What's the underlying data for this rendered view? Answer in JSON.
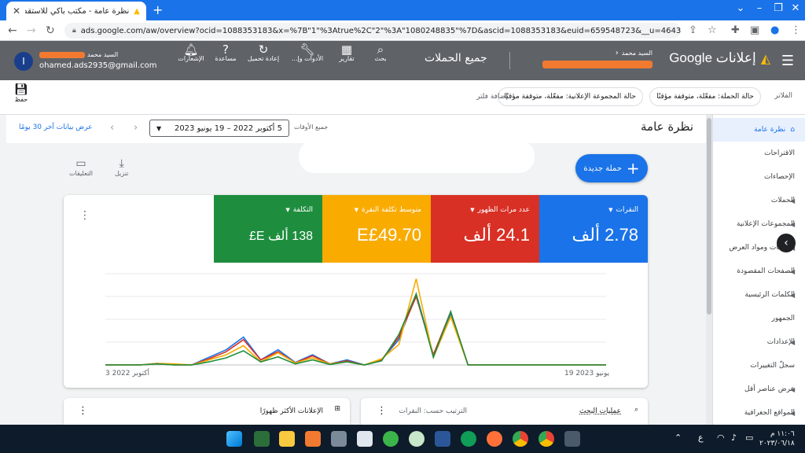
{
  "browser": {
    "tab_title": "نظرة عامة - مكتب باكي للاستقدام",
    "url": "ads.google.com/aw/overview?ocid=1088353183&x=%7B\"1\"%3Atrue%2C\"2\"%3A\"1080248835\"%7D&ascid=1088353183&euid=659548723&__u=4643380827&usc..."
  },
  "header": {
    "product_name": "إعلانات Google",
    "account_label": "السيد محمد",
    "page_context": "جميع الحملات",
    "tools": [
      {
        "icon": "search-icon",
        "label": "بحث"
      },
      {
        "icon": "reports-icon",
        "label": "تقارير"
      },
      {
        "icon": "tools-icon",
        "label": "الأدوات وإ..."
      },
      {
        "icon": "refresh-icon",
        "label": "إعادة تحميل"
      },
      {
        "icon": "help-icon",
        "label": "مساعدة"
      },
      {
        "icon": "bell-icon",
        "label": "الإشعارات"
      }
    ],
    "user_name": "السيد محمد",
    "user_email": "ohamed.ads2935@gmail.com",
    "avatar_letter": "I"
  },
  "filterbar": {
    "save_label": "حفظ",
    "filters_label": "الفلاتر",
    "chips": [
      "حالة الحملة: مفعّلة، متوقفة مؤقتًا",
      "حالة المجموعة الإعلانية: مفعّلة، متوقفة مؤقتًا"
    ],
    "add_filter": "إضافة فلتر"
  },
  "overview": {
    "title": "نظرة عامة",
    "all_time": "جميع الأوقات",
    "date_range": "5 أكتوبر 2022 – 19 يونيو 2023",
    "show_last": "عرض بيانات آخر 30 يومًا",
    "download_label": "تنزيل",
    "comments_label": "التعليقات",
    "new_campaign": "حملة جديدة"
  },
  "metrics": [
    {
      "label": "النقرات",
      "value": "2.78 ألف",
      "color": "#1a73e8"
    },
    {
      "label": "عدد مرات الظهور",
      "value": "24.1 ألف",
      "color": "#d93025"
    },
    {
      "label": "متوسط تكلفة النقرة",
      "value": "E£49.70",
      "color": "#f9ab00"
    },
    {
      "label": "التكلفة",
      "value": "138 ألف E£",
      "color": "#1e8e3e"
    }
  ],
  "chart_data": {
    "type": "line",
    "x_start_label": "3 أكتوبر 2022",
    "x_end_label": "19 يونيو 2023",
    "grid": true,
    "series": [
      {
        "color": "#1a73e8",
        "values": [
          0,
          0,
          0,
          0.3,
          0,
          0,
          1.5,
          3,
          5.5,
          1,
          3,
          0.5,
          2,
          0.2,
          1,
          0,
          1,
          5,
          14,
          2,
          10,
          0,
          0,
          0,
          0,
          0,
          0,
          0,
          0,
          0
        ]
      },
      {
        "color": "#d93025",
        "values": [
          0,
          0,
          0,
          0.2,
          0,
          0,
          1.2,
          2.6,
          5,
          1,
          2.6,
          0.4,
          1.8,
          0.2,
          0.8,
          0,
          1,
          5.5,
          13.5,
          2,
          10.5,
          0,
          0,
          0,
          0,
          0,
          0,
          0,
          0,
          0
        ]
      },
      {
        "color": "#f9ab00",
        "values": [
          0,
          0,
          0,
          0.3,
          0.2,
          0,
          1,
          2,
          3.8,
          0.6,
          2.4,
          0.4,
          1.4,
          0.2,
          0.6,
          0,
          1.2,
          4,
          17,
          1.5,
          9.5,
          0,
          0,
          0,
          0,
          0,
          0,
          0,
          0,
          0
        ]
      },
      {
        "color": "#1e8e3e",
        "values": [
          0,
          0,
          0,
          0.2,
          0,
          0,
          0.6,
          1.4,
          2.8,
          0.6,
          1.6,
          0.2,
          1,
          0.1,
          0.6,
          0,
          0.8,
          6,
          14,
          1.5,
          10.5,
          0,
          0,
          0,
          0,
          0,
          0,
          0,
          0,
          0
        ]
      }
    ]
  },
  "bottom_cards": {
    "search_terms": "عمليات البحث",
    "sort_by": "الترتيب حسب: النقرات",
    "top_ads": "الإعلانات الأكثر ظهورًا"
  },
  "sidenav": {
    "items": [
      {
        "label": "نظرة عامة",
        "active": true,
        "caret": false
      },
      {
        "label": "الاقتراحات",
        "active": false,
        "caret": false
      },
      {
        "label": "الإحصاءات",
        "active": false,
        "caret": false
      },
      {
        "label": "الحملات",
        "active": false,
        "caret": true
      },
      {
        "label": "المجموعات الإعلانية",
        "active": false,
        "caret": true
      },
      {
        "label": "الإعلانات ومواد العرض",
        "active": false,
        "caret": true
      },
      {
        "label": "الصفحات المقصودة",
        "active": false,
        "caret": true
      },
      {
        "label": "الكلمات الرئيسية",
        "active": false,
        "caret": true
      },
      {
        "label": "الجمهور",
        "active": false,
        "caret": false
      },
      {
        "label": "الإعدادات",
        "active": false,
        "caret": true
      },
      {
        "label": "سجلّ التغييرات",
        "active": false,
        "caret": false
      },
      {
        "label": "عرض عناصر أقل",
        "active": false,
        "caret": true
      },
      {
        "label": "المواقع الجغرافية",
        "active": false,
        "caret": true
      }
    ]
  },
  "taskbar": {
    "time": "١١:٠٦ م",
    "date": "٢٠٢٣/٠٦/١٨",
    "lang": "ع"
  }
}
